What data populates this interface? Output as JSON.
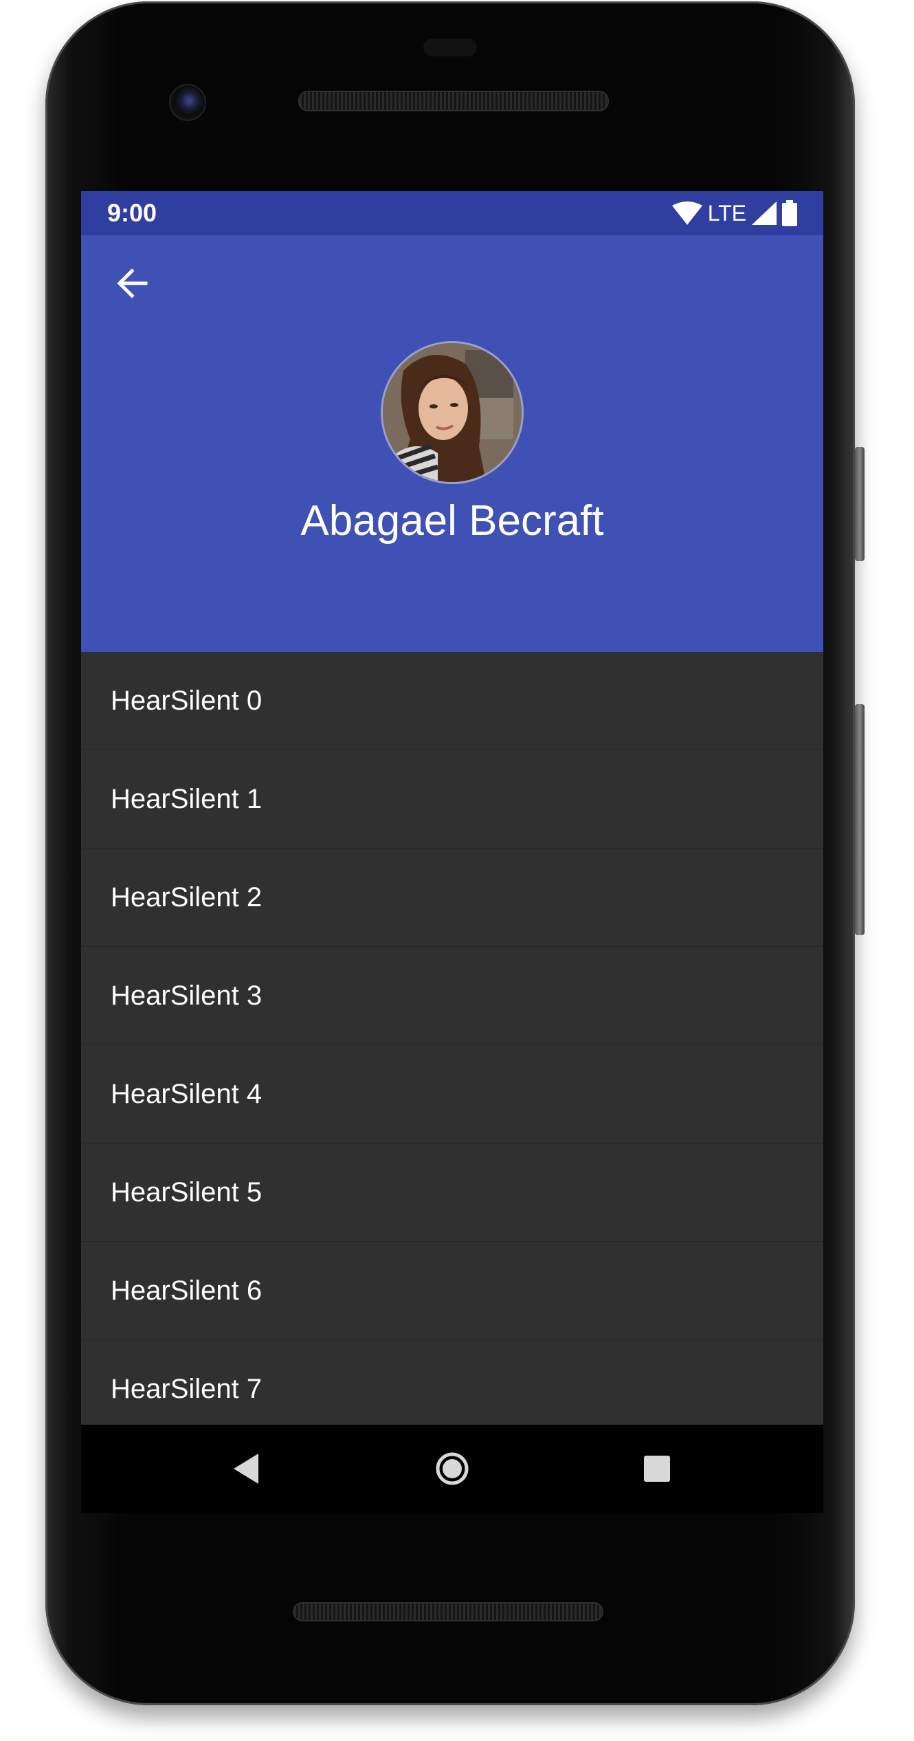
{
  "status_bar": {
    "time": "9:00",
    "network": "LTE",
    "icons": [
      "wifi-icon",
      "signal-icon",
      "battery-icon"
    ]
  },
  "header": {
    "back_icon": "arrow-back-icon",
    "profile_name": "Abagael Becraft",
    "avatar": "profile-photo"
  },
  "list": {
    "items": [
      {
        "label": "HearSilent 0"
      },
      {
        "label": "HearSilent 1"
      },
      {
        "label": "HearSilent 2"
      },
      {
        "label": "HearSilent 3"
      },
      {
        "label": "HearSilent 4"
      },
      {
        "label": "HearSilent 5"
      },
      {
        "label": "HearSilent 6"
      },
      {
        "label": "HearSilent 7"
      }
    ]
  },
  "navigation": {
    "buttons": [
      "back-triangle-icon",
      "home-circle-icon",
      "overview-square-icon"
    ]
  },
  "colors": {
    "status_bar": "#303f9f",
    "header": "#3f51b5",
    "list_background": "#303030",
    "text": "#ffffff"
  }
}
